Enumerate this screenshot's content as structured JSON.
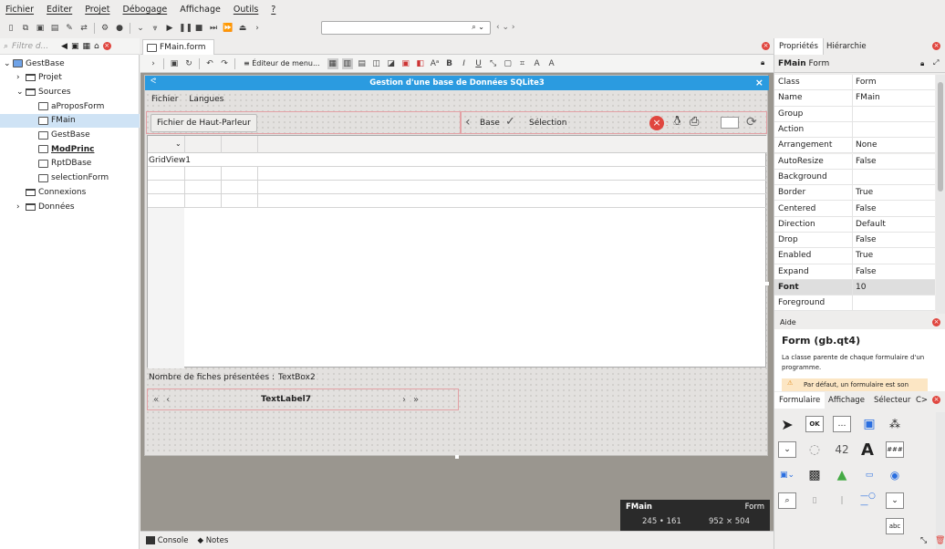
{
  "menubar": {
    "items": [
      "Fichier",
      "Editer",
      "Projet",
      "Débogage",
      "Affichage",
      "Outils",
      "?"
    ]
  },
  "left": {
    "filter_placeholder": "Filtre d...",
    "tree": [
      {
        "label": "GestBase",
        "indent": 4,
        "kind": "project",
        "arrow": "v"
      },
      {
        "label": "Projet",
        "indent": 18,
        "kind": "folder",
        "arrow": ">"
      },
      {
        "label": "Sources",
        "indent": 18,
        "kind": "folder",
        "arrow": "v"
      },
      {
        "label": "aProposForm",
        "indent": 42,
        "kind": "form"
      },
      {
        "label": "FMain",
        "indent": 42,
        "kind": "form",
        "selected": true
      },
      {
        "label": "GestBase",
        "indent": 42,
        "kind": "form"
      },
      {
        "label": "ModPrinc",
        "indent": 42,
        "kind": "module",
        "bold": true
      },
      {
        "label": "RptDBase",
        "indent": 42,
        "kind": "report"
      },
      {
        "label": "selectionForm",
        "indent": 42,
        "kind": "form"
      },
      {
        "label": "Connexions",
        "indent": 28,
        "kind": "folder"
      },
      {
        "label": "Données",
        "indent": 18,
        "kind": "folder",
        "arrow": ">"
      }
    ]
  },
  "center": {
    "tab_label": "FMain.form",
    "menu_editor": "Éditeur de menu...",
    "form": {
      "title": "Gestion d'une base de Données SQLite3",
      "menu": [
        "Fichier",
        "Langues"
      ],
      "haut_parleur": "Fichier de Haut-Parleur",
      "base": "Base",
      "selection": "Sélection",
      "gridview": "GridView1",
      "status_label": "Nombre de fiches présentées :",
      "status_value": "TextBox2",
      "nav_label": "TextLabel7"
    },
    "info": {
      "name": "FMain",
      "type": "Form",
      "pos": "245 • 161",
      "size": "952 × 504"
    }
  },
  "right": {
    "tabs": [
      "Propriétés",
      "Hiérarchie"
    ],
    "header_name": "FMain",
    "header_type": "Form",
    "props": [
      [
        "Class",
        "Form"
      ],
      [
        "Name",
        "FMain"
      ],
      [
        "Group",
        ""
      ],
      [
        "Action",
        ""
      ],
      [
        "Arrangement",
        "None"
      ],
      [
        "AutoResize",
        "False"
      ],
      [
        "Background",
        ""
      ],
      [
        "Border",
        "True"
      ],
      [
        "Centered",
        "False"
      ],
      [
        "Direction",
        "Default"
      ],
      [
        "Drop",
        "False"
      ],
      [
        "Enabled",
        "True"
      ],
      [
        "Expand",
        "False"
      ],
      [
        "Font",
        "10"
      ],
      [
        "Foreground",
        ""
      ]
    ],
    "aide": {
      "header": "Aide",
      "title": "Form (gb.qt4)",
      "text": "La classe parente de chaque formulaire d'un programme.",
      "warning": "Par défaut, un formulaire est son"
    },
    "palette_tabs": [
      "Formulaire",
      "Affichage",
      "Sélecteur",
      "C>"
    ]
  },
  "bottom": {
    "console": "Console",
    "notes": "Notes"
  },
  "colors": {
    "accent": "#2b9be0",
    "close": "#e0463f",
    "panel_border": "#e3a1a5"
  }
}
